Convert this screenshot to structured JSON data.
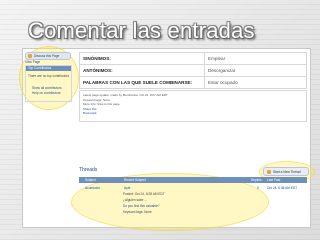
{
  "slide": {
    "title": "Comentar las entradas"
  },
  "sidebar": {
    "discuss_button": "Discuss this Page",
    "history_link": "View Page",
    "contributors_header": "Top Contributors",
    "contributors_text": "There are no top contributors",
    "show_all": "Show all contributors",
    "help": "Help on contributors"
  },
  "table": {
    "rows": [
      {
        "key": "SINÓNIMOS:",
        "value": "Emplear"
      },
      {
        "key": "ANTÓNIMOS:",
        "value": "Desorganizar"
      },
      {
        "key": "PALABRAS CON LAS QUE SUELE COMBINARSE:",
        "value": "Estar ocupado"
      }
    ]
  },
  "meta": {
    "line1": "Latest page update: made by Membresía, Oct 24, 8:07 AM EDT",
    "line2": "Keyword tags: None",
    "line3": "More Info: links to this page",
    "line4": "Share this",
    "line5": "Bookmark"
  },
  "thread": {
    "label": "Threads",
    "reply_button": "Start a New Thread",
    "headers": {
      "subject": "Subject",
      "recent": "Recent Subject",
      "replies": "Replies",
      "last": "Last Post"
    },
    "row": {
      "name": "Acueducto",
      "author": "Apie",
      "posted": "Posted: Oct 24, 8:38 AM EDT",
      "body": "¿Alguien sabe ...",
      "more": "Do you find this valuable?",
      "last": "Keyword tags: None",
      "replies": "0",
      "last_post": "Oct 24, 8:38 AM EDT"
    }
  }
}
